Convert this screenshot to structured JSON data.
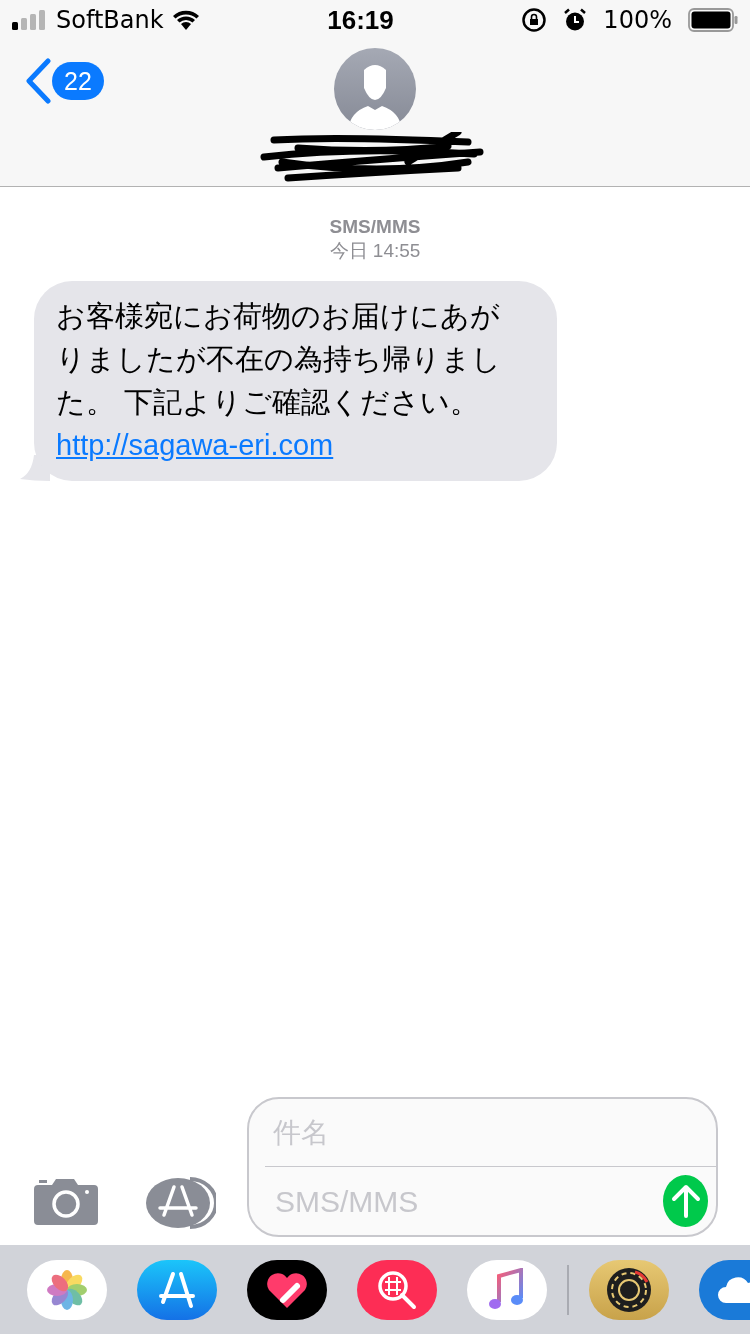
{
  "status_bar": {
    "carrier": "SoftBank",
    "time": "16:19",
    "battery": "100%"
  },
  "nav": {
    "back_count": "22"
  },
  "conversation": {
    "service": "SMS/MMS",
    "timestamp": "今日 14:55"
  },
  "messages": [
    {
      "text": "お客様宛にお荷物のお届けにあがりましたが不在の為持ち帰りました。 下記よりご確認ください。",
      "link": "http://sagawa-eri.com"
    }
  ],
  "composer": {
    "subject_placeholder": "件名",
    "message_placeholder": "SMS/MMS"
  }
}
